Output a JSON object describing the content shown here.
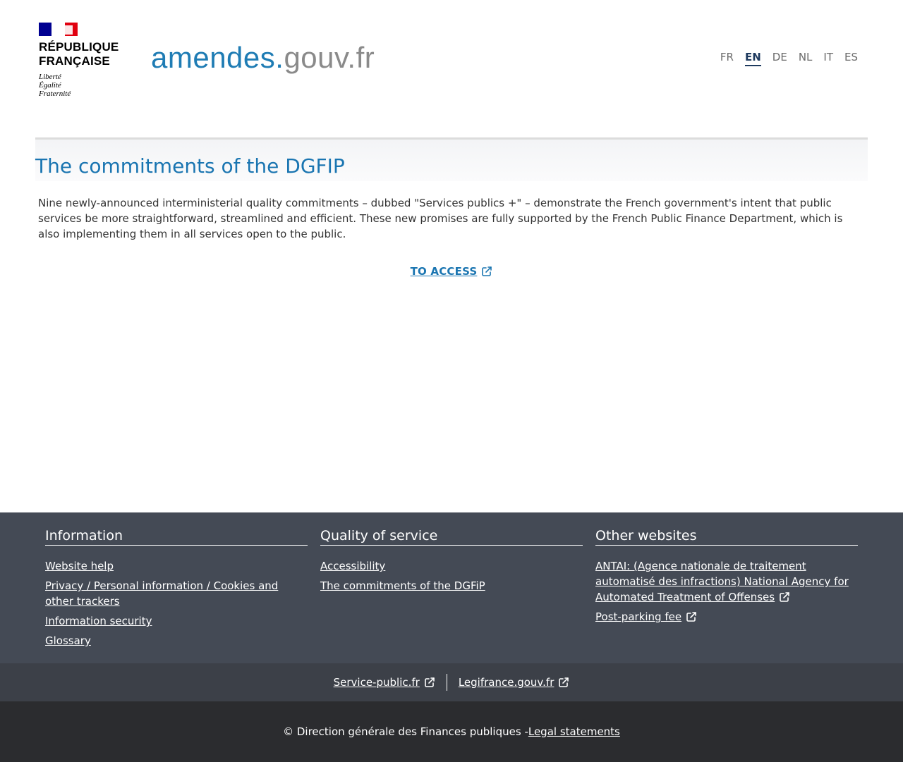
{
  "header": {
    "gov_name_line1": "RÉPUBLIQUE",
    "gov_name_line2": "FRANÇAISE",
    "motto_line1": "Liberté",
    "motto_line2": "Égalité",
    "motto_line3": "Fraternité",
    "brand_part1": "amendes.",
    "brand_part2": "gouv.fr",
    "brand_colors": {
      "primary": "#1f7cb4",
      "secondary": "#8a8a8a"
    },
    "languages": [
      {
        "code": "FR",
        "active": false
      },
      {
        "code": "EN",
        "active": true
      },
      {
        "code": "DE",
        "active": false
      },
      {
        "code": "NL",
        "active": false
      },
      {
        "code": "IT",
        "active": false
      },
      {
        "code": "ES",
        "active": false
      }
    ]
  },
  "main": {
    "title": "The commitments of the DGFIP",
    "intro": "Nine newly-announced interministerial quality commitments – dubbed \"Services publics +\" – demonstrate the French government's intent that public services be more straightforward, streamlined and efficient. These new promises are fully supported by the French Public Finance Department, which is also implementing them in all services open to the public.",
    "access_label": "TO ACCESS",
    "access_icon": "external-link-icon"
  },
  "footer": {
    "columns": [
      {
        "heading": "Information",
        "links": [
          {
            "label": "Website help",
            "external": false
          },
          {
            "label": "Privacy / Personal information / Cookies and other trackers",
            "external": false
          },
          {
            "label": "Information security",
            "external": false
          },
          {
            "label": "Glossary",
            "external": false
          }
        ]
      },
      {
        "heading": "Quality of service",
        "links": [
          {
            "label": "Accessibility",
            "external": false
          },
          {
            "label": "The commitments of the DGFiP",
            "external": false
          }
        ]
      },
      {
        "heading": "Other websites",
        "links": [
          {
            "label": "ANTAI: (Agence nationale de traitement automatisé des infractions) National Agency for Automated Treatment of Offenses",
            "external": true
          },
          {
            "label": "Post-parking fee",
            "external": true
          }
        ]
      }
    ],
    "partner_links": [
      {
        "label": "Service-public.fr",
        "external": true
      },
      {
        "label": "Legifrance.gouv.fr",
        "external": true
      }
    ],
    "copyright": "© Direction générale des Finances publiques - ",
    "legal_label": "Legal statements"
  }
}
